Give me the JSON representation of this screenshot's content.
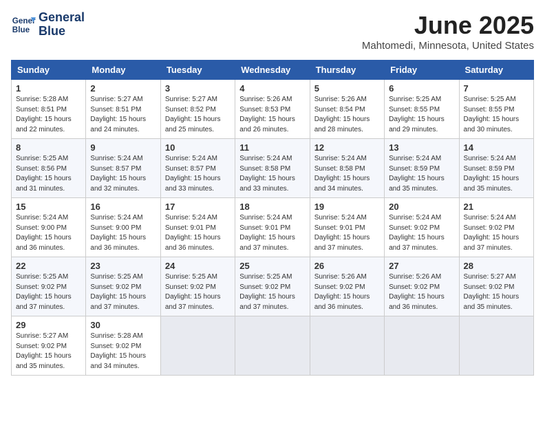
{
  "logo": {
    "line1": "General",
    "line2": "Blue"
  },
  "title": "June 2025",
  "location": "Mahtomedi, Minnesota, United States",
  "weekdays": [
    "Sunday",
    "Monday",
    "Tuesday",
    "Wednesday",
    "Thursday",
    "Friday",
    "Saturday"
  ],
  "weeks": [
    [
      {
        "day": "1",
        "info": "Sunrise: 5:28 AM\nSunset: 8:51 PM\nDaylight: 15 hours\nand 22 minutes."
      },
      {
        "day": "2",
        "info": "Sunrise: 5:27 AM\nSunset: 8:51 PM\nDaylight: 15 hours\nand 24 minutes."
      },
      {
        "day": "3",
        "info": "Sunrise: 5:27 AM\nSunset: 8:52 PM\nDaylight: 15 hours\nand 25 minutes."
      },
      {
        "day": "4",
        "info": "Sunrise: 5:26 AM\nSunset: 8:53 PM\nDaylight: 15 hours\nand 26 minutes."
      },
      {
        "day": "5",
        "info": "Sunrise: 5:26 AM\nSunset: 8:54 PM\nDaylight: 15 hours\nand 28 minutes."
      },
      {
        "day": "6",
        "info": "Sunrise: 5:25 AM\nSunset: 8:55 PM\nDaylight: 15 hours\nand 29 minutes."
      },
      {
        "day": "7",
        "info": "Sunrise: 5:25 AM\nSunset: 8:55 PM\nDaylight: 15 hours\nand 30 minutes."
      }
    ],
    [
      {
        "day": "8",
        "info": "Sunrise: 5:25 AM\nSunset: 8:56 PM\nDaylight: 15 hours\nand 31 minutes."
      },
      {
        "day": "9",
        "info": "Sunrise: 5:24 AM\nSunset: 8:57 PM\nDaylight: 15 hours\nand 32 minutes."
      },
      {
        "day": "10",
        "info": "Sunrise: 5:24 AM\nSunset: 8:57 PM\nDaylight: 15 hours\nand 33 minutes."
      },
      {
        "day": "11",
        "info": "Sunrise: 5:24 AM\nSunset: 8:58 PM\nDaylight: 15 hours\nand 33 minutes."
      },
      {
        "day": "12",
        "info": "Sunrise: 5:24 AM\nSunset: 8:58 PM\nDaylight: 15 hours\nand 34 minutes."
      },
      {
        "day": "13",
        "info": "Sunrise: 5:24 AM\nSunset: 8:59 PM\nDaylight: 15 hours\nand 35 minutes."
      },
      {
        "day": "14",
        "info": "Sunrise: 5:24 AM\nSunset: 8:59 PM\nDaylight: 15 hours\nand 35 minutes."
      }
    ],
    [
      {
        "day": "15",
        "info": "Sunrise: 5:24 AM\nSunset: 9:00 PM\nDaylight: 15 hours\nand 36 minutes."
      },
      {
        "day": "16",
        "info": "Sunrise: 5:24 AM\nSunset: 9:00 PM\nDaylight: 15 hours\nand 36 minutes."
      },
      {
        "day": "17",
        "info": "Sunrise: 5:24 AM\nSunset: 9:01 PM\nDaylight: 15 hours\nand 36 minutes."
      },
      {
        "day": "18",
        "info": "Sunrise: 5:24 AM\nSunset: 9:01 PM\nDaylight: 15 hours\nand 37 minutes."
      },
      {
        "day": "19",
        "info": "Sunrise: 5:24 AM\nSunset: 9:01 PM\nDaylight: 15 hours\nand 37 minutes."
      },
      {
        "day": "20",
        "info": "Sunrise: 5:24 AM\nSunset: 9:02 PM\nDaylight: 15 hours\nand 37 minutes."
      },
      {
        "day": "21",
        "info": "Sunrise: 5:24 AM\nSunset: 9:02 PM\nDaylight: 15 hours\nand 37 minutes."
      }
    ],
    [
      {
        "day": "22",
        "info": "Sunrise: 5:25 AM\nSunset: 9:02 PM\nDaylight: 15 hours\nand 37 minutes."
      },
      {
        "day": "23",
        "info": "Sunrise: 5:25 AM\nSunset: 9:02 PM\nDaylight: 15 hours\nand 37 minutes."
      },
      {
        "day": "24",
        "info": "Sunrise: 5:25 AM\nSunset: 9:02 PM\nDaylight: 15 hours\nand 37 minutes."
      },
      {
        "day": "25",
        "info": "Sunrise: 5:25 AM\nSunset: 9:02 PM\nDaylight: 15 hours\nand 37 minutes."
      },
      {
        "day": "26",
        "info": "Sunrise: 5:26 AM\nSunset: 9:02 PM\nDaylight: 15 hours\nand 36 minutes."
      },
      {
        "day": "27",
        "info": "Sunrise: 5:26 AM\nSunset: 9:02 PM\nDaylight: 15 hours\nand 36 minutes."
      },
      {
        "day": "28",
        "info": "Sunrise: 5:27 AM\nSunset: 9:02 PM\nDaylight: 15 hours\nand 35 minutes."
      }
    ],
    [
      {
        "day": "29",
        "info": "Sunrise: 5:27 AM\nSunset: 9:02 PM\nDaylight: 15 hours\nand 35 minutes."
      },
      {
        "day": "30",
        "info": "Sunrise: 5:28 AM\nSunset: 9:02 PM\nDaylight: 15 hours\nand 34 minutes."
      },
      {
        "day": "",
        "info": ""
      },
      {
        "day": "",
        "info": ""
      },
      {
        "day": "",
        "info": ""
      },
      {
        "day": "",
        "info": ""
      },
      {
        "day": "",
        "info": ""
      }
    ]
  ]
}
